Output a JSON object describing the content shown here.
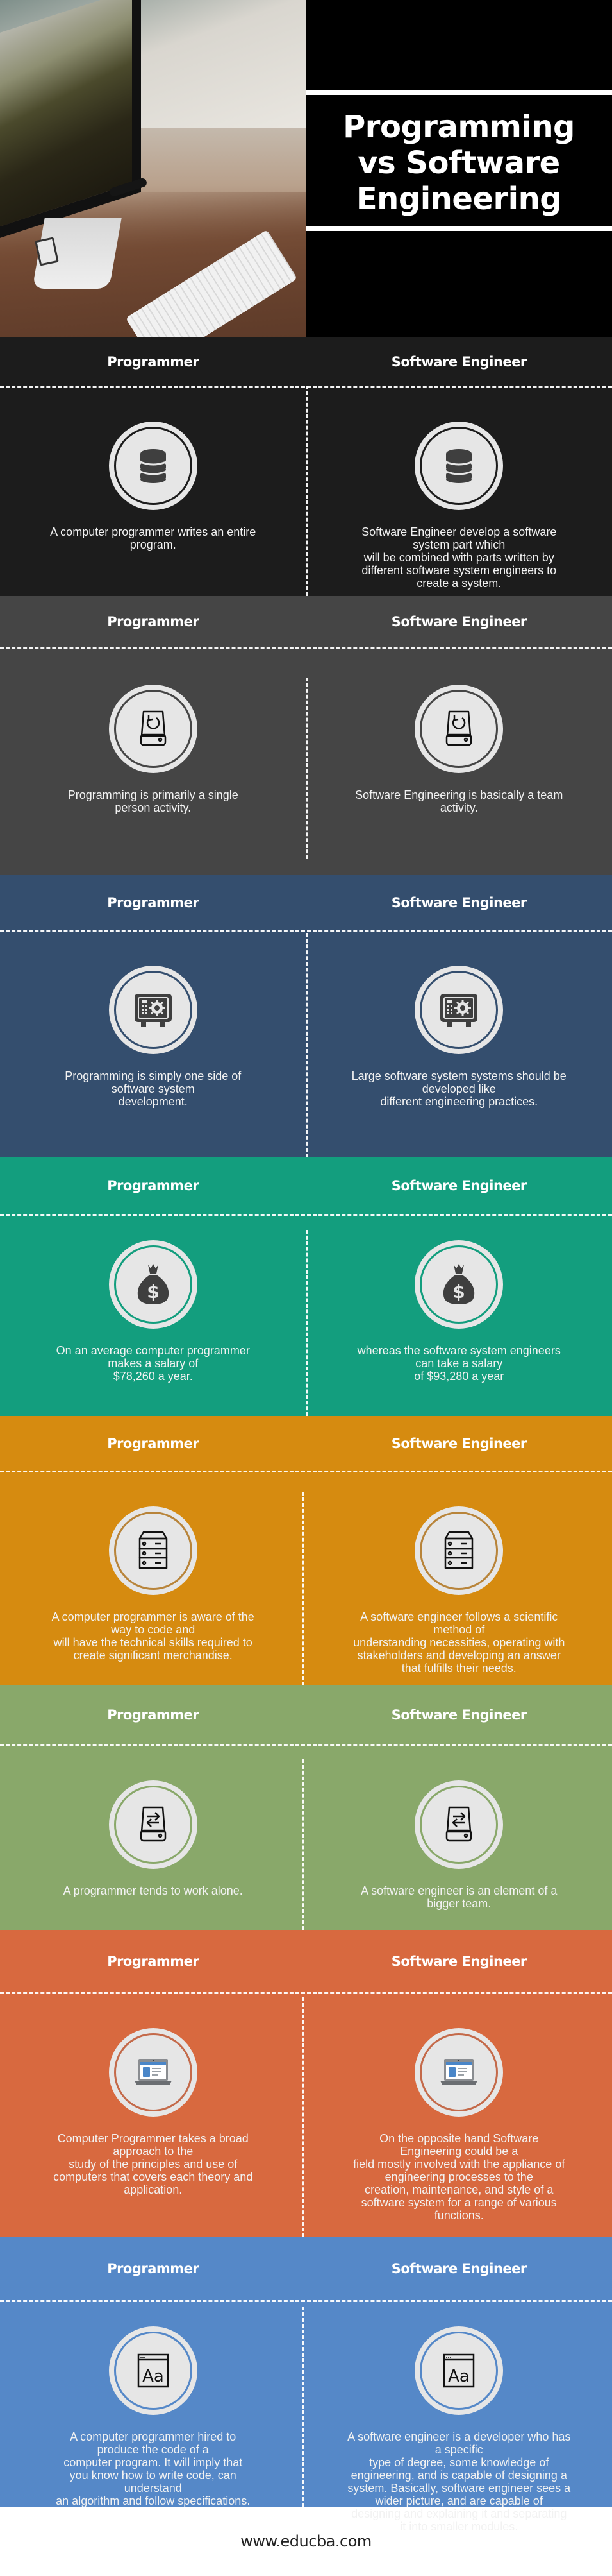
{
  "hero": {
    "title_lines": [
      "Programming",
      "vs Software",
      "Engineering"
    ]
  },
  "columns": {
    "left": "Programmer",
    "right": "Software Engineer"
  },
  "sections": [
    {
      "bg": "#1c1c1c",
      "ring": "#1c1c1c",
      "icon": "database-icon",
      "left": "A computer programmer writes an entire\nprogram.",
      "right": "Software Engineer develop a software\nsystem part which\nwill be combined with parts written by\ndifferent software system engineers to\ncreate a system."
    },
    {
      "bg": "#454545",
      "ring": "#454545",
      "icon": "drive-sync-icon",
      "left": "Programming is primarily a single\nperson activity.",
      "right": "Software Engineering is basically a team\nactivity."
    },
    {
      "bg": "#344e6e",
      "ring": "#344e6e",
      "icon": "safe-icon",
      "left": "Programming is simply one side of\nsoftware system\ndevelopment.",
      "right": "Large software system systems should be\ndeveloped like\ndifferent engineering practices."
    },
    {
      "bg": "#139e7e",
      "ring": "#139e7e",
      "icon": "money-bag-icon",
      "left": "On an average computer programmer\nmakes a salary of\n$78,260 a year.",
      "right": "whereas the software system engineers\ncan take a salary\nof $93,280 a year"
    },
    {
      "bg": "#d68b10",
      "ring": "#b8843a",
      "icon": "server-icon",
      "left": "A computer programmer is aware of the\nway to code and\nwill have the technical skills required to\ncreate significant merchandise.",
      "right": "A software engineer follows a scientific\nmethod of\nunderstanding necessities, operating with\nstakeholders and developing an answer\nthat fulfills their needs."
    },
    {
      "bg": "#89a86a",
      "ring": "#89a86a",
      "icon": "drive-transfer-icon",
      "left": "A programmer tends to work alone.",
      "right": "A software engineer is an element of a\nbigger team."
    },
    {
      "bg": "#d8693f",
      "ring": "#c46a4a",
      "icon": "laptop-icon",
      "left": "Computer Programmer takes a broad\napproach to the\nstudy of the principles and use of\ncomputers that covers each theory and\napplication.",
      "right": "On the opposite hand Software\nEngineering could be a\nfield mostly involved with the appliance of\nengineering processes to the\ncreation, maintenance, and style of a\nsoftware system for a range of various\nfunctions."
    },
    {
      "bg": "#5588c8",
      "ring": "#5588c8",
      "icon": "font-window-icon",
      "left": "A computer programmer hired to\nproduce the code of a\ncomputer program. It will imply that\nyou know how to write code, can\nunderstand\nan algorithm and follow specifications.",
      "right": "A software engineer is a developer who has\na specific\ntype of degree, some knowledge of\nengineering, and is capable of designing a\nsystem. Basically, software engineer sees a\nwider picture, and are capable of\ndesigning and explaining it and separating\nit into smaller modules."
    }
  ],
  "footer": {
    "site": "www.educba.com"
  }
}
